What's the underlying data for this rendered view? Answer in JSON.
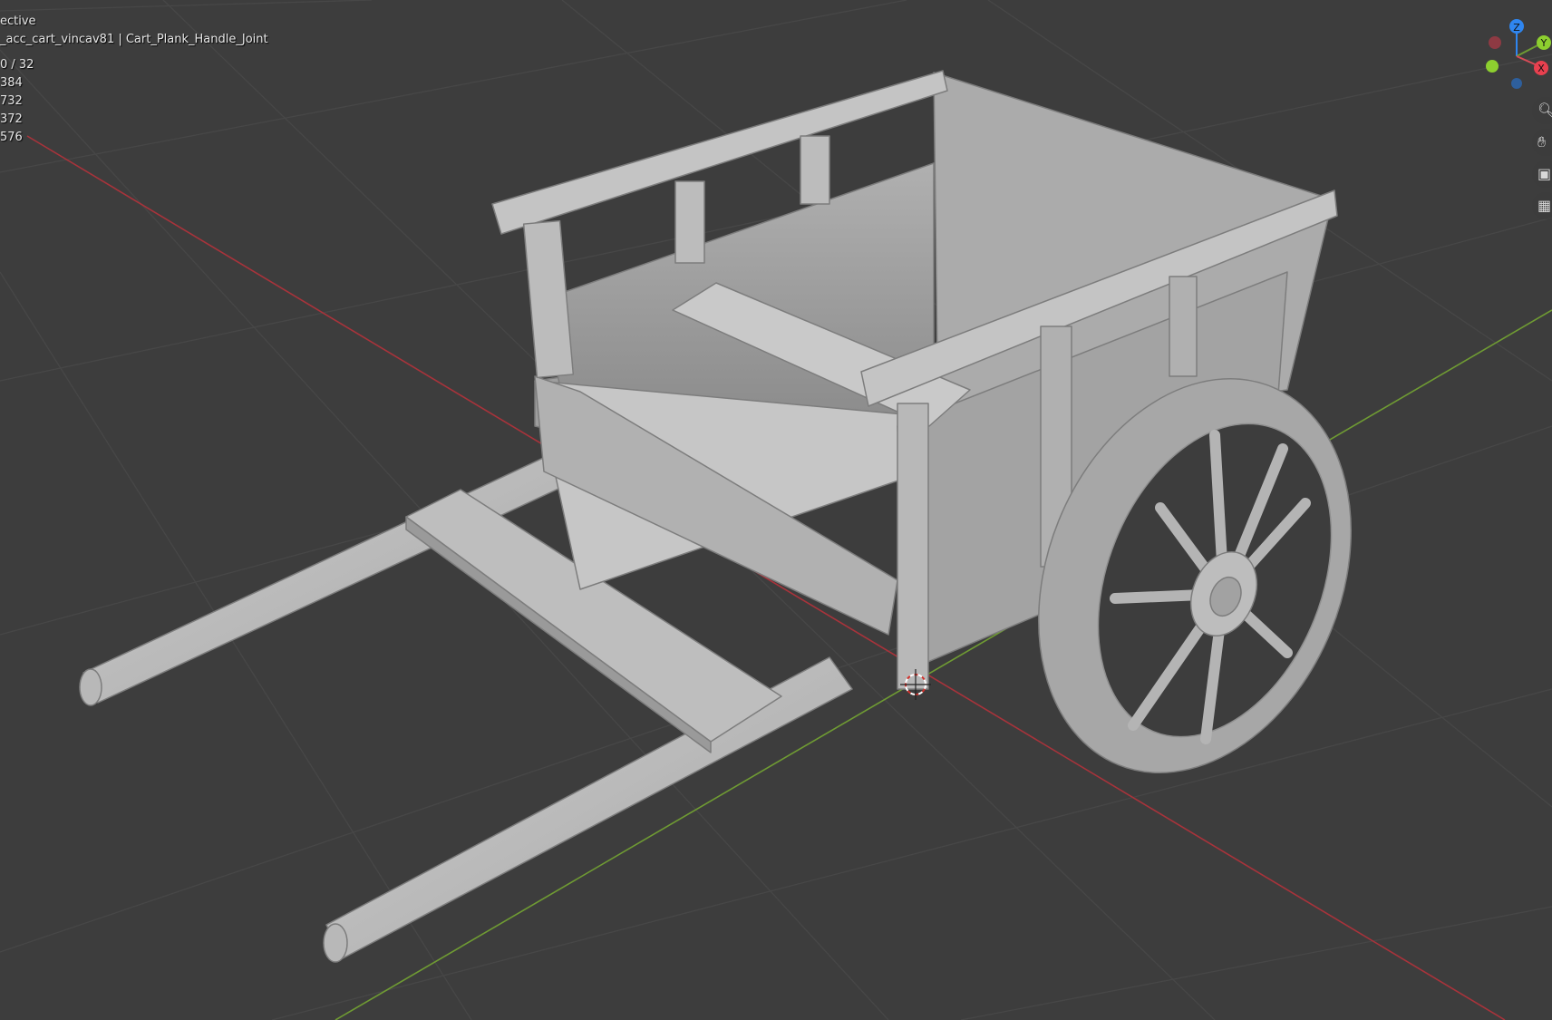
{
  "viewport": {
    "mode_label": "ective",
    "collection_object": "_acc_cart_vincav81 | Cart_Plank_Handle_Joint",
    "stats": [
      "0 / 32",
      "384",
      "732",
      "372",
      "576"
    ]
  },
  "gizmo": {
    "z_label": "Z",
    "y_label": "Y",
    "x_label": "X"
  },
  "nav_tools": {
    "zoom": "zoom-icon",
    "pan": "hand-icon",
    "camera": "camera-icon",
    "ortho": "grid-icon"
  },
  "colors": {
    "background": "#3d3d3d",
    "grid": "#474747",
    "x_axis": "#a8333b",
    "y_axis": "#6f9b33",
    "z_gizmo": "#2f86f0",
    "mesh_light": "#c8c8c8",
    "mesh_mid": "#a9a9a9",
    "mesh_dark": "#8a8a8a"
  }
}
